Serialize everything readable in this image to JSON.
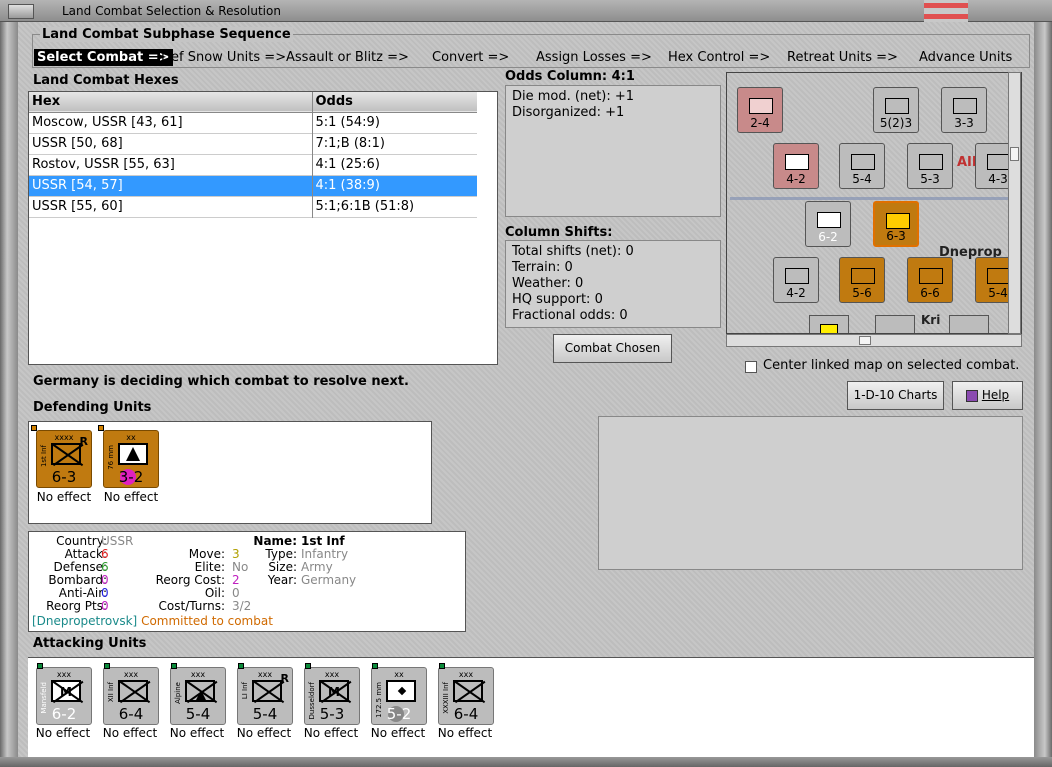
{
  "window": {
    "title": "Land Combat Selection & Resolution"
  },
  "subphase": {
    "heading": "Land Combat Subphase Sequence",
    "steps": [
      "Select Combat =>",
      "Def Snow Units =>",
      "Assault or Blitz =>",
      "Convert =>",
      "Assign Losses =>",
      "Hex Control =>",
      "Retreat Units =>",
      "Advance Units"
    ]
  },
  "hexes": {
    "heading": "Land Combat Hexes",
    "columns": [
      "Hex",
      "Odds"
    ],
    "rows": [
      {
        "hex": "Moscow, USSR [43, 61]",
        "odds": "5:1 (54:9)"
      },
      {
        "hex": "USSR [50, 68]",
        "odds": "7:1;B (8:1)"
      },
      {
        "hex": "Rostov, USSR [55, 63]",
        "odds": "4:1 (25:6)"
      },
      {
        "hex": "USSR [54, 57]",
        "odds": "4:1 (38:9)"
      },
      {
        "hex": "USSR [55, 60]",
        "odds": "5:1;6:1B (51:8)"
      }
    ],
    "selected_index": 3
  },
  "odds": {
    "heading": "Odds Column: 4:1",
    "die_mod": "Die mod. (net): +1",
    "disorganized": "Disorganized: +1"
  },
  "shifts": {
    "heading": "Column Shifts:",
    "lines": [
      "Total shifts (net): 0",
      "Terrain: 0",
      "Weather: 0",
      "HQ support: 0",
      "Fractional odds: 0"
    ]
  },
  "buttons": {
    "combat_chosen": "Combat Chosen",
    "charts": "1-D-10 Charts",
    "help": "Help"
  },
  "center_map": {
    "label": "Center linked map on selected combat.",
    "checked": false
  },
  "status_message": "Germany is deciding which combat to resolve next.",
  "defending": {
    "heading": "Defending Units",
    "units": [
      {
        "top": "xxxx",
        "side": "1st Inf",
        "value": "6-3",
        "corner": "R",
        "effect": "No effect",
        "kind": "inf",
        "color": "orange"
      },
      {
        "top": "xx",
        "side": "76 mm",
        "value": "3-2",
        "corner": "",
        "effect": "No effect",
        "kind": "art",
        "color": "orange"
      }
    ]
  },
  "unit_info": {
    "country_label": "Country:",
    "country": "USSR",
    "attack_label": "Attack:",
    "attack": "6",
    "defense_label": "Defense:",
    "defense": "6",
    "bombard_label": "Bombard:",
    "bombard": "0",
    "antiair_label": "Anti-Air:",
    "antiair": "0",
    "reorg_label": "Reorg Pts:",
    "reorg": "0",
    "move_label": "Move:",
    "move": "3",
    "elite_label": "Elite:",
    "elite": "No",
    "reorg_cost_label": "Reorg Cost:",
    "reorg_cost": "2",
    "oil_label": "Oil:",
    "oil": "0",
    "cost_label": "Cost/Turns:",
    "cost": "3/2",
    "name_label": "Name:",
    "name": "1st Inf",
    "type_label": "Type:",
    "type": "Infantry",
    "size_label": "Size:",
    "size": "Army",
    "year_label": "Year:",
    "year": "Germany",
    "location": "[Dnepropetrovsk]",
    "committed": "Committed to combat"
  },
  "attacking": {
    "heading": "Attacking Units",
    "units": [
      {
        "top": "xxx",
        "side": "Mansfeld",
        "value": "6-2",
        "corner": "",
        "effect": "No effect",
        "kind": "mech"
      },
      {
        "top": "xxx",
        "side": "XII Inf",
        "value": "6-4",
        "corner": "",
        "effect": "No effect",
        "kind": "inf"
      },
      {
        "top": "xxx",
        "side": "Alpine",
        "value": "5-4",
        "corner": "",
        "effect": "No effect",
        "kind": "mtn"
      },
      {
        "top": "xxx",
        "side": "LI Inf",
        "value": "5-4",
        "corner": "R",
        "effect": "No effect",
        "kind": "inf"
      },
      {
        "top": "xxx",
        "side": "Dusseldorf",
        "value": "5-3",
        "corner": "",
        "effect": "No effect",
        "kind": "mech"
      },
      {
        "top": "xx",
        "side": "172.5 mm",
        "value": "5-2",
        "corner": "",
        "effect": "No effect",
        "kind": "dot"
      },
      {
        "top": "xxx",
        "side": "XXXIII Inf",
        "value": "6-4",
        "corner": "",
        "effect": "No effect",
        "kind": "inf"
      }
    ]
  },
  "map": {
    "labels": [
      "AIN",
      "Dneprop",
      "Kri"
    ],
    "counters": [
      {
        "value": "2-4",
        "color": "pink"
      },
      {
        "value": "5(2)3",
        "color": "grey"
      },
      {
        "value": "3-3",
        "color": "grey"
      },
      {
        "value": "4-2",
        "color": "pink"
      },
      {
        "value": "5-4",
        "color": "grey"
      },
      {
        "value": "5-3",
        "color": "grey"
      },
      {
        "value": "4-3",
        "color": "grey"
      },
      {
        "value": "6-2",
        "color": "grey"
      },
      {
        "value": "6-3",
        "color": "orange"
      },
      {
        "value": "4-2",
        "color": "grey"
      },
      {
        "value": "5-6",
        "color": "orange"
      },
      {
        "value": "6-6",
        "color": "orange"
      },
      {
        "value": "5-4",
        "color": "orange"
      }
    ]
  },
  "colors": {
    "selection": "#3399ff",
    "soviet": "#c07a10",
    "german": "#bcbcbc",
    "location": "#1a8a8a",
    "committed": "#d06a00"
  }
}
